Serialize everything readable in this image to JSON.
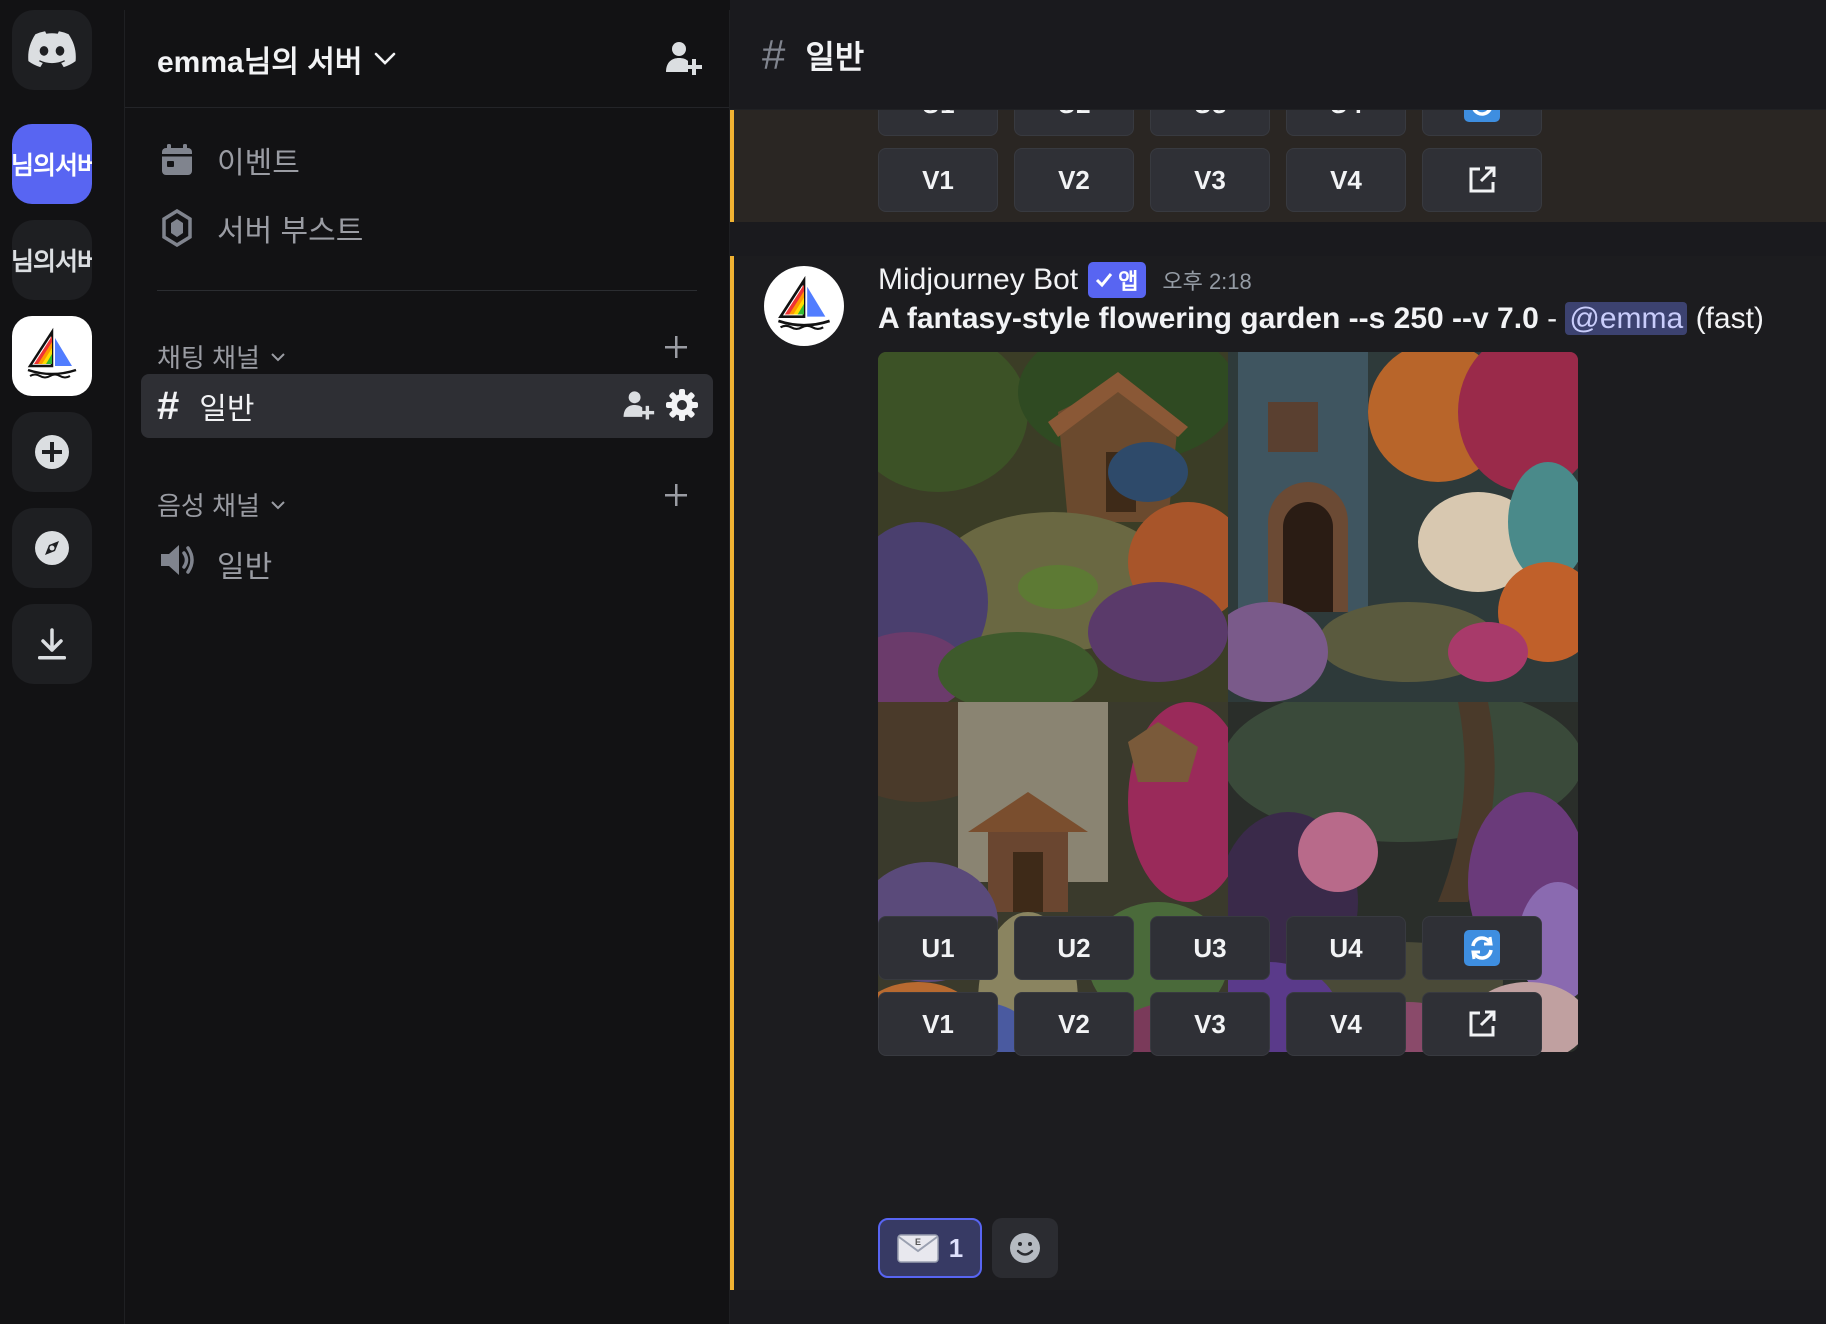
{
  "servers": [
    {
      "name": "discord-home",
      "label": ""
    },
    {
      "name": "server-1",
      "label": "님의서버"
    },
    {
      "name": "server-2",
      "label": "님의서버"
    },
    {
      "name": "midjourney-server",
      "label": ""
    }
  ],
  "guild": {
    "name": "emma님의 서버"
  },
  "sidebar": {
    "events_label": "이벤트",
    "boost_label": "서버 부스트",
    "text_category": "채팅 채널",
    "voice_category": "음성 채널",
    "active_channel": "일반",
    "voice_channel": "일반"
  },
  "channel": {
    "hash": "#",
    "title": "일반"
  },
  "message": {
    "author": "Midjourney Bot",
    "app_tag": "앱",
    "timestamp": "오후 2:18",
    "prompt_bold": "A fantasy-style flowering garden --s 250 --v 7.0",
    "prompt_sep": " - ",
    "mention": "@emma",
    "suffix": " (fast)"
  },
  "buttons": {
    "upscale": [
      "U1",
      "U2",
      "U3",
      "U4"
    ],
    "variation": [
      "V1",
      "V2",
      "V3",
      "V4"
    ]
  },
  "reactions": {
    "mail_count": "1"
  },
  "colors": {
    "accent": "#5865f2",
    "highlight_border": "#f0b232"
  }
}
